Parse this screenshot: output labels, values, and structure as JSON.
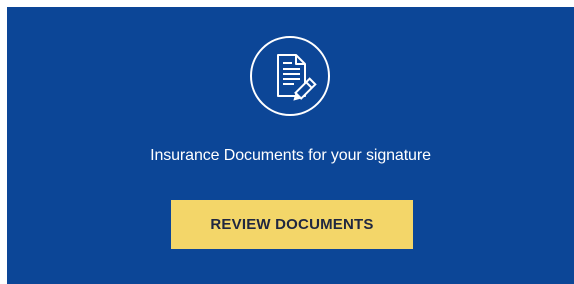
{
  "card": {
    "icon": "document-signing-icon",
    "headline": "Insurance Documents for your signature",
    "button_label": "REVIEW DOCUMENTS"
  },
  "colors": {
    "background": "#0c4697",
    "button": "#f3d669",
    "button_text": "#1f2740",
    "text": "#ffffff"
  }
}
